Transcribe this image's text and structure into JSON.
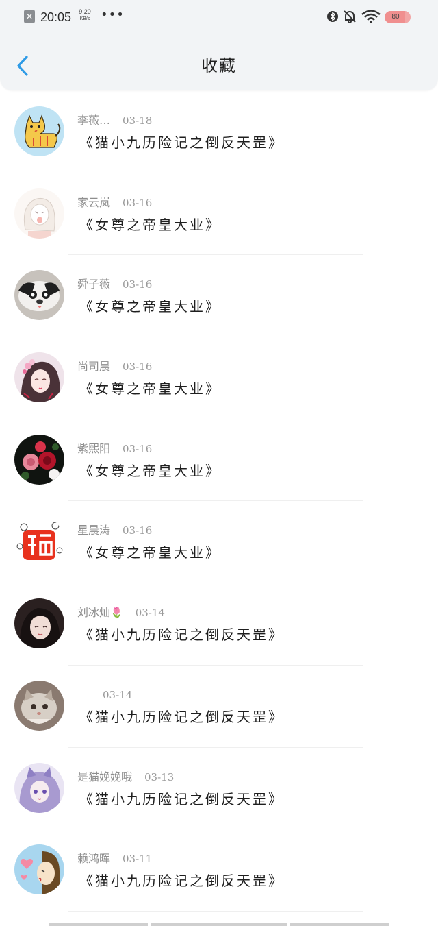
{
  "status_bar": {
    "time": "20:05",
    "speed_value": "9.20",
    "speed_unit": "KB/s",
    "more": "•••",
    "battery": "80",
    "battery_level": 0.8,
    "icons": [
      "close-icon",
      "bluetooth-icon",
      "mute-bell-icon",
      "wifi-icon",
      "battery-icon"
    ]
  },
  "header": {
    "title": "收藏",
    "back_icon": "chevron-left-icon",
    "accent": "#2f9be6"
  },
  "items": [
    {
      "name": "李薇…",
      "date": "03-18",
      "book": "《猫小九历险记之倒反天罡》"
    },
    {
      "name": "家云岚",
      "date": "03-16",
      "book": "《女尊之帝皇大业》"
    },
    {
      "name": "舜子薇",
      "date": "03-16",
      "book": "《女尊之帝皇大业》"
    },
    {
      "name": "尚司晨",
      "date": "03-16",
      "book": "《女尊之帝皇大业》"
    },
    {
      "name": "紫熙阳",
      "date": "03-16",
      "book": "《女尊之帝皇大业》"
    },
    {
      "name": "星晨涛",
      "date": "03-16",
      "book": "《女尊之帝皇大业》"
    },
    {
      "name": "刘冰灿",
      "emoji": "🌷",
      "date": "03-14",
      "book": "《猫小九历险记之倒反天罡》"
    },
    {
      "name": "",
      "date": "03-14",
      "book": "《猫小九历险记之倒反天罡》"
    },
    {
      "name": "是猫娩娩哦",
      "date": "03-13",
      "book": "《猫小九历险记之倒反天罡》"
    },
    {
      "name": "赖鸿晖",
      "date": "03-11",
      "book": "《猫小九历险记之倒反天罡》"
    }
  ]
}
